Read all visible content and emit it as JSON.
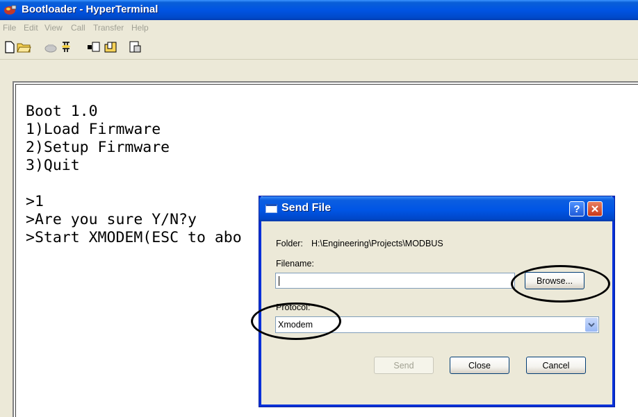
{
  "window": {
    "title": "Bootloader - HyperTerminal"
  },
  "menu": [
    "File",
    "Edit",
    "View",
    "Call",
    "Transfer",
    "Help"
  ],
  "toolbar": [
    "new-icon",
    "open-icon",
    "call-icon",
    "disconnect-icon",
    "send-icon",
    "receive-icon",
    "properties-icon"
  ],
  "terminal": {
    "lines": [
      "Boot 1.0",
      "1)Load Firmware",
      "2)Setup Firmware",
      "3)Quit",
      "",
      ">1",
      ">Are you sure Y/N?y",
      ">Start XMODEM(ESC to abo"
    ]
  },
  "dialog": {
    "title": "Send File",
    "help_label": "?",
    "folder_label": "Folder:",
    "folder_path": "H:\\Engineering\\Projects\\MODBUS",
    "filename_label": "Filename:",
    "filename_value": "",
    "browse_label": "Browse...",
    "protocol_label": "Protocol:",
    "protocol_value": "Xmodem",
    "send_label": "Send",
    "close_label": "Close",
    "cancel_label": "Cancel"
  }
}
